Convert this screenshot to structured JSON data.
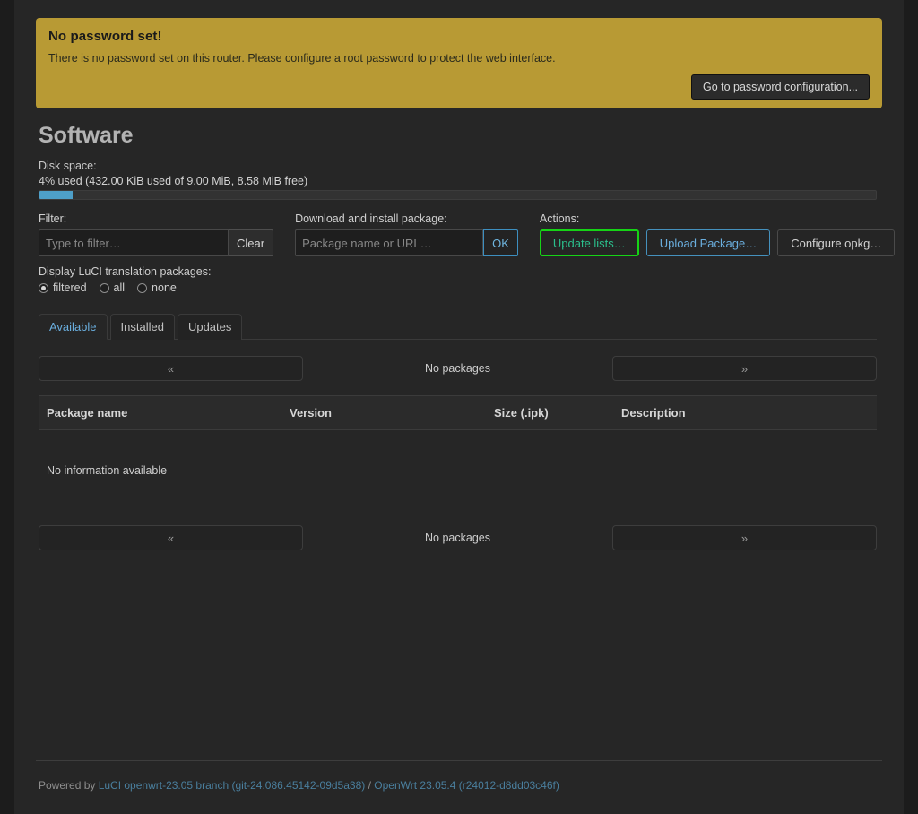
{
  "banner": {
    "title": "No password set!",
    "message": "There is no password set on this router. Please configure a root password to protect the web interface.",
    "button_label": "Go to password configuration...",
    "background_color": "#b89a34"
  },
  "page": {
    "title": "Software"
  },
  "disk": {
    "label": "Disk space:",
    "usage_text": "4% used (432.00 KiB used of 9.00 MiB, 8.58 MiB free)",
    "percent_used": 4,
    "fill_color": "#4e9fc8"
  },
  "filter": {
    "label": "Filter:",
    "placeholder": "Type to filter…",
    "value": "",
    "clear_label": "Clear"
  },
  "download": {
    "label": "Download and install package:",
    "placeholder": "Package name or URL…",
    "value": "",
    "ok_label": "OK",
    "ok_color": "#6fb6e0"
  },
  "actions": {
    "label": "Actions:",
    "buttons": [
      {
        "label": "Update lists…",
        "style": "green",
        "color": "#16d316"
      },
      {
        "label": "Upload Package…",
        "style": "blue",
        "color": "#4591bd"
      },
      {
        "label": "Configure opkg…",
        "style": "grey",
        "color": "#4a4a4a"
      }
    ]
  },
  "translation": {
    "label": "Display LuCI translation packages:",
    "options": [
      {
        "label": "filtered",
        "selected": true
      },
      {
        "label": "all",
        "selected": false
      },
      {
        "label": "none",
        "selected": false
      }
    ]
  },
  "tabs": [
    {
      "label": "Available",
      "active": true
    },
    {
      "label": "Installed",
      "active": false
    },
    {
      "label": "Updates",
      "active": false
    }
  ],
  "pager_top": {
    "prev_label": "«",
    "next_label": "»",
    "info": "No packages"
  },
  "pager_bottom": {
    "prev_label": "«",
    "next_label": "»",
    "info": "No packages"
  },
  "table": {
    "columns": [
      "Package name",
      "Version",
      "Size (.ipk)",
      "Description"
    ],
    "rows": [],
    "empty_message": "No information available"
  },
  "footer": {
    "prefix": "Powered by ",
    "luci_link": "LuCI openwrt-23.05 branch (git-24.086.45142-09d5a38)",
    "separator": " / ",
    "openwrt_link": "OpenWrt 23.05.4 (r24012-d8dd03c46f)"
  }
}
